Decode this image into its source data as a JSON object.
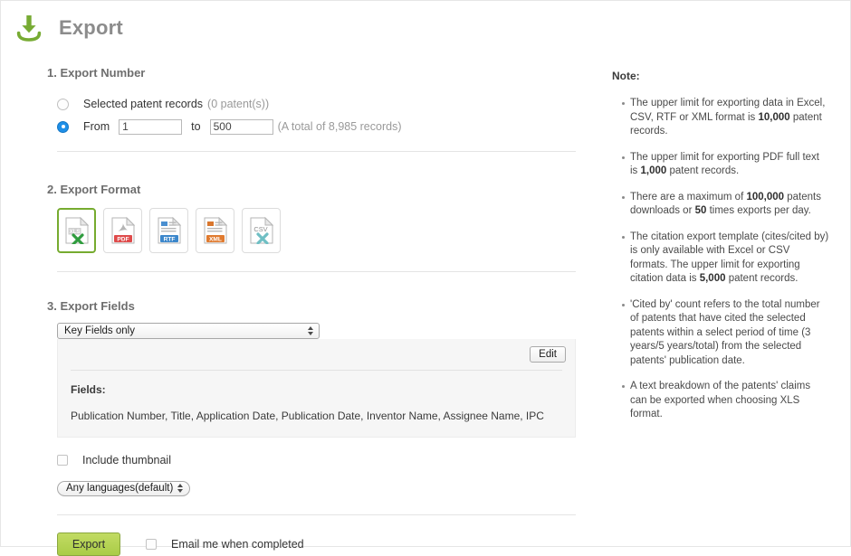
{
  "header": {
    "icon": "download-icon",
    "title": "Export"
  },
  "sections": {
    "export_number": {
      "title": "1. Export Number",
      "option_selected_records": {
        "label": "Selected patent records",
        "count_text": "(0 patent(s))",
        "checked": false
      },
      "option_range": {
        "label": "From",
        "from_value": "1",
        "to_label": "to",
        "to_value": "500",
        "total_text": "(A total of 8,985 records)",
        "checked": true
      }
    },
    "export_format": {
      "title": "2. Export Format",
      "options": [
        {
          "label": "XLS",
          "selected": true
        },
        {
          "label": "PDF",
          "selected": false
        },
        {
          "label": "RTF",
          "selected": false
        },
        {
          "label": "XML",
          "selected": false
        },
        {
          "label": "CSV",
          "selected": false
        }
      ]
    },
    "export_fields": {
      "title": "3. Export Fields",
      "template_selected": "Key Fields only",
      "edit_label": "Edit",
      "fields_label": "Fields:",
      "fields_value": "Publication Number, Title, Application Date, Publication Date, Inventor Name, Assignee Name, IPC"
    },
    "options": {
      "include_thumbnail_label": "Include thumbnail",
      "include_thumbnail_checked": false,
      "language_selected": "Any languages(default)"
    },
    "actions": {
      "export_label": "Export",
      "email_label": "Email me when completed",
      "email_checked": false
    }
  },
  "note": {
    "heading": "Note:",
    "items": [
      {
        "parts": [
          {
            "t": "The upper limit for exporting data in Excel, CSV, RTF or XML format is ",
            "b": false
          },
          {
            "t": "10,000",
            "b": true
          },
          {
            "t": " patent records.",
            "b": false
          }
        ]
      },
      {
        "parts": [
          {
            "t": "The upper limit for exporting PDF full text is ",
            "b": false
          },
          {
            "t": "1,000",
            "b": true
          },
          {
            "t": " patent records.",
            "b": false
          }
        ]
      },
      {
        "parts": [
          {
            "t": "There are a maximum of ",
            "b": false
          },
          {
            "t": "100,000",
            "b": true
          },
          {
            "t": " patents downloads or ",
            "b": false
          },
          {
            "t": "50",
            "b": true
          },
          {
            "t": " times exports per day.",
            "b": false
          }
        ]
      },
      {
        "parts": [
          {
            "t": "The citation export template (cites/cited by) is only available with Excel or CSV formats. The upper limit for exporting citation data is ",
            "b": false
          },
          {
            "t": "5,000",
            "b": true
          },
          {
            "t": " patent records.",
            "b": false
          }
        ]
      },
      {
        "parts": [
          {
            "t": "'Cited by' count refers to the total number of patents that have cited the selected patents within a select period of time (3 years/5 years/total) from the selected patents' publication date.",
            "b": false
          }
        ]
      },
      {
        "parts": [
          {
            "t": "A text breakdown of the patents' claims can be exported when choosing XLS format.",
            "b": false
          }
        ]
      }
    ]
  },
  "colors": {
    "brand_green": "#76ab2f",
    "button_green": "#aacc47",
    "radio_blue": "#1e8fe8",
    "title_gray": "#8c8c8c"
  }
}
